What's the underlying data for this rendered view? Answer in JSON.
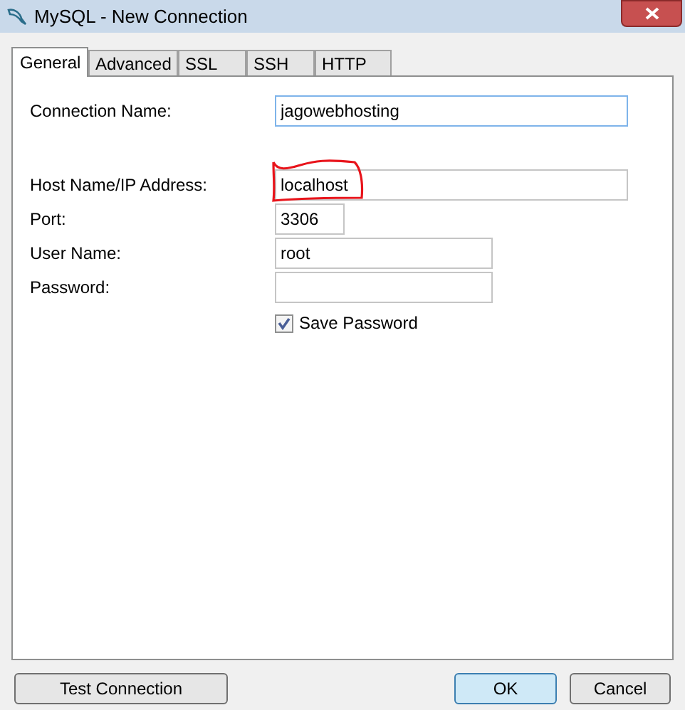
{
  "window": {
    "title": "MySQL - New Connection"
  },
  "tabs": [
    {
      "label": "General",
      "selected": true
    },
    {
      "label": "Advanced",
      "selected": false
    },
    {
      "label": "SSL",
      "selected": false
    },
    {
      "label": "SSH",
      "selected": false
    },
    {
      "label": "HTTP",
      "selected": false
    }
  ],
  "fields": [
    {
      "label": "Connection Name:",
      "value": "jagowebhosting",
      "focused": true
    },
    {
      "label": "Host Name/IP Address:",
      "value": "localhost",
      "focused": false,
      "annotated": true
    },
    {
      "label": "Port:",
      "value": "3306",
      "focused": false
    },
    {
      "label": "User Name:",
      "value": "root",
      "focused": false
    },
    {
      "label": "Password:",
      "focused": false
    }
  ],
  "save_password": {
    "label": "Save Password",
    "checked": true
  },
  "buttons": [
    {
      "label": "Test Connection",
      "kind": "left",
      "default": false
    },
    {
      "label": "OK",
      "kind": "right",
      "default": true
    },
    {
      "label": "Cancel",
      "kind": "right",
      "default": false
    }
  ]
}
